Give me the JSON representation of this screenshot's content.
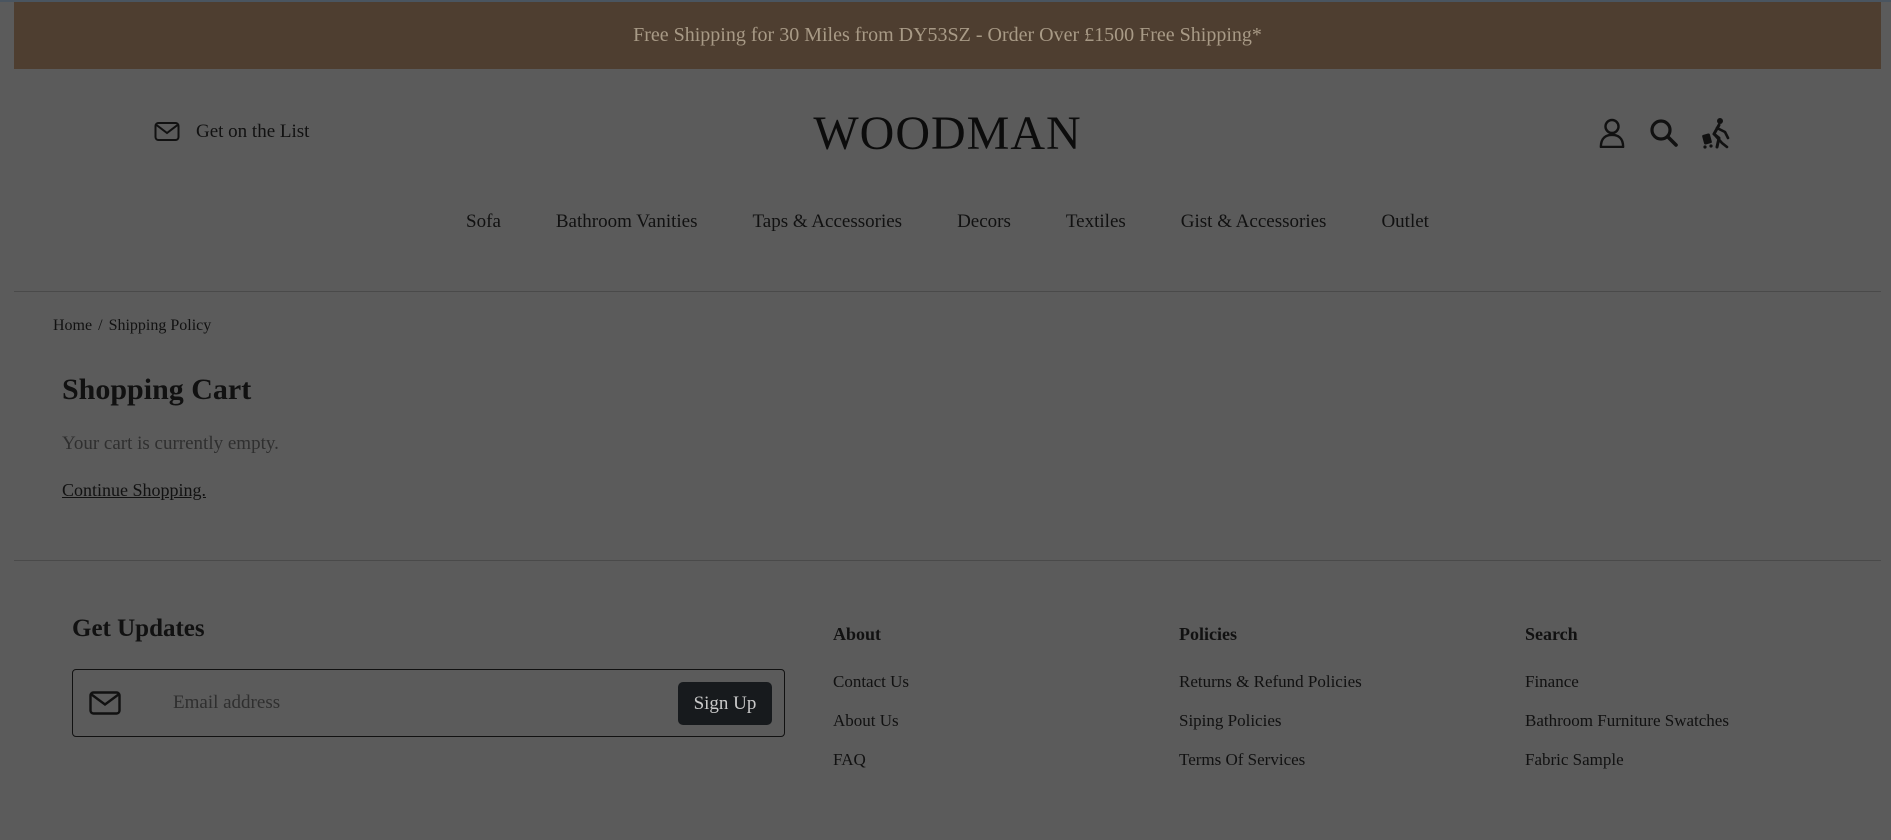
{
  "announcement": "Free Shipping for 30 Miles from DY53SZ - Order Over £1500 Free Shipping*",
  "header": {
    "get_on_list": "Get on the List",
    "logo": "WOODMAN",
    "icons": [
      "account-icon",
      "search-icon",
      "cart-icon"
    ]
  },
  "nav": {
    "items": [
      "Sofa",
      "Bathroom Vanities",
      "Taps & Accessories",
      "Decors",
      "Textiles",
      "Gist & Accessories",
      "Outlet"
    ]
  },
  "breadcrumb": {
    "home": "Home",
    "separator": "/",
    "current": "Shipping Policy"
  },
  "cart": {
    "title": "Shopping Cart",
    "empty_message": "Your cart is currently empty.",
    "continue_link": "Continue Shopping."
  },
  "footer": {
    "updates_title": "Get Updates",
    "email_placeholder": "Email address",
    "signup_label": "Sign Up",
    "columns": [
      {
        "title": "About",
        "links": [
          "Contact Us",
          "About Us",
          "FAQ"
        ]
      },
      {
        "title": "Policies",
        "links": [
          "Returns & Refund Policies",
          "Siping Policies",
          "Terms Of Services"
        ]
      },
      {
        "title": "Search",
        "links": [
          "Finance",
          "Bathroom Furniture Swatches",
          "Fabric Sample"
        ]
      }
    ]
  },
  "colors": {
    "page_bg": "#5b5b5b",
    "announce_bg": "#4e3e30",
    "announce_text": "#a89a86",
    "button_bg": "#171a1d"
  }
}
